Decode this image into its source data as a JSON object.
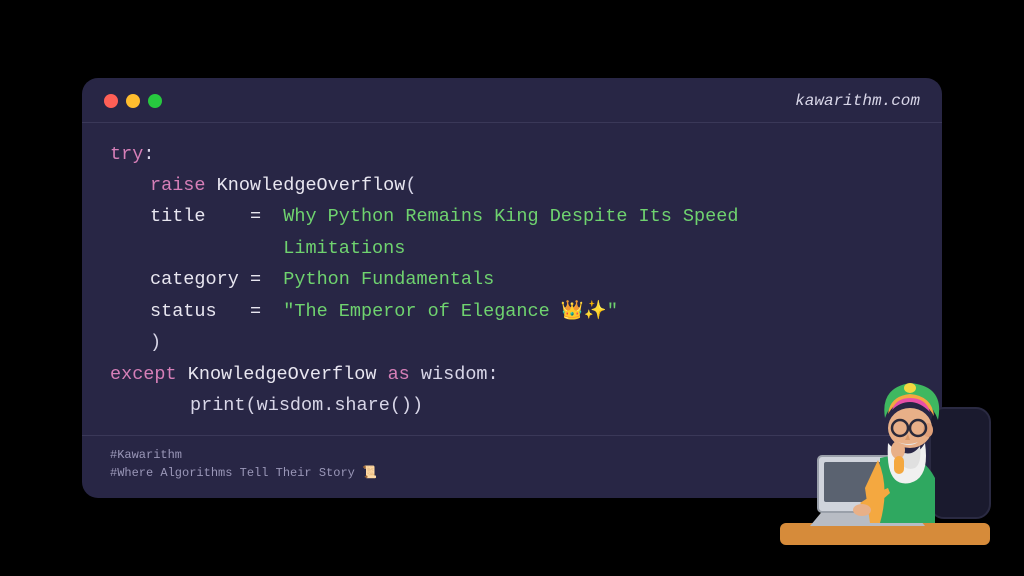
{
  "titlebar": {
    "site": "kawarithm.com"
  },
  "code": {
    "try": "try",
    "colon": ":",
    "raise": "raise",
    "class_name": "KnowledgeOverflow",
    "open_paren": "(",
    "arg_title": "title",
    "eq": "=",
    "title_val_l1": "Why Python Remains King Despite Its Speed",
    "title_val_l2": "Limitations",
    "arg_category": "category",
    "category_val": "Python Fundamentals",
    "arg_status": "status",
    "status_val": "\"The Emperor of Elegance 👑✨\"",
    "close_paren": ")",
    "except": "except",
    "as": "as",
    "wisdom": "wisdom",
    "print_call": "print(wisdom.share())"
  },
  "footer": {
    "tag1": "#Kawarithm",
    "tag2": "#Where Algorithms Tell Their Story 📜"
  }
}
